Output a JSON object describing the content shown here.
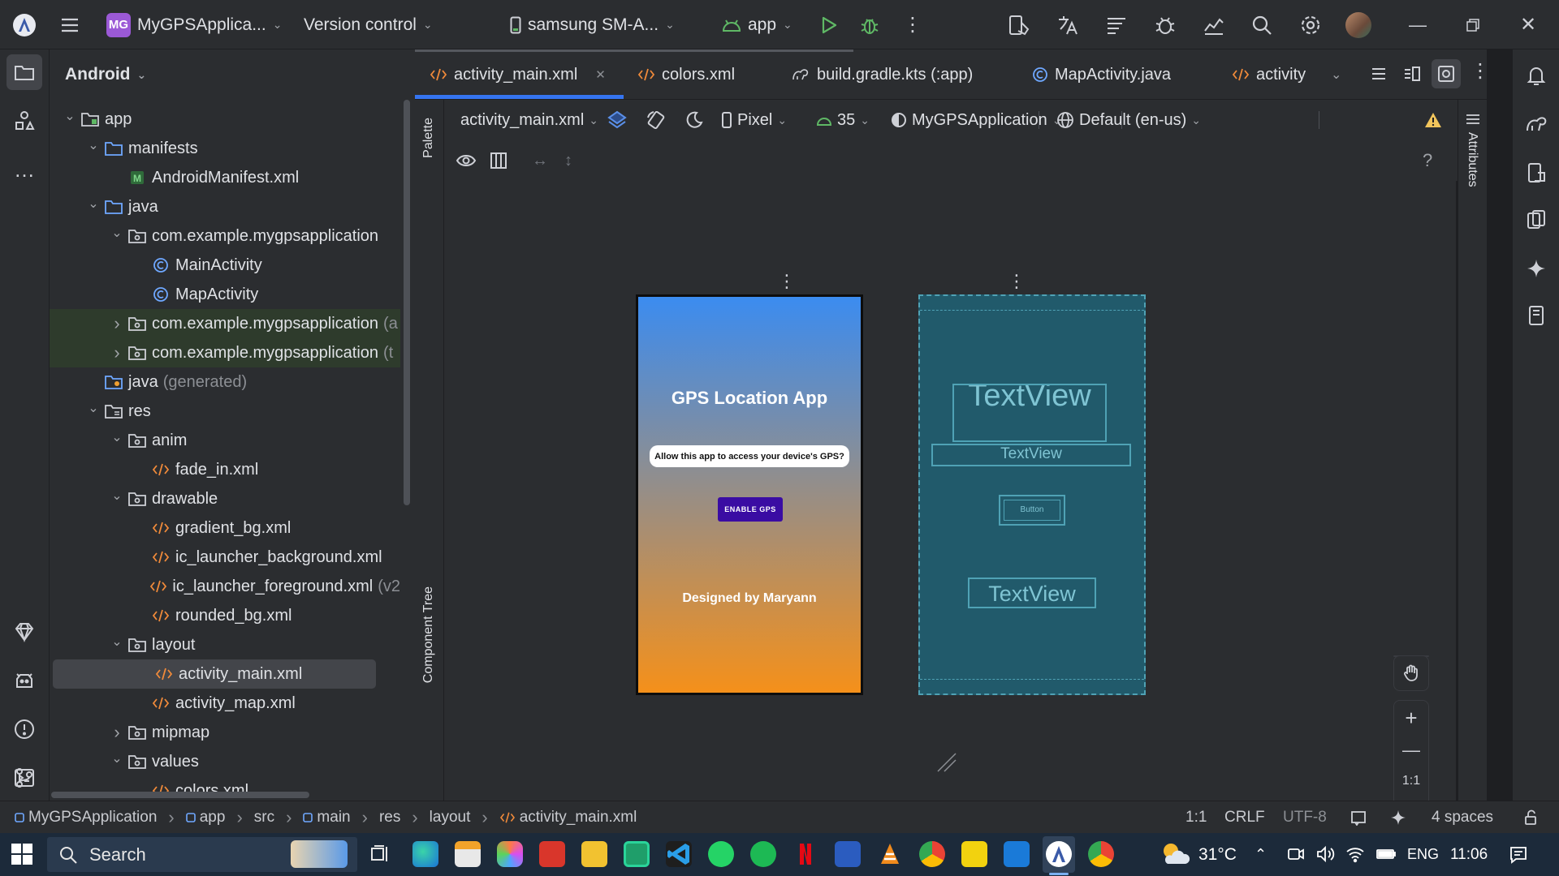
{
  "titlebar": {
    "project_badge": "MG",
    "project_name": "MyGPSApplica...",
    "vcs": "Version control",
    "device": "samsung SM-A...",
    "run_config": "app"
  },
  "project_panel": {
    "view_mode": "Android",
    "tree": [
      {
        "label": "app",
        "level": 0,
        "expand": "open",
        "icon": "module-folder-icon"
      },
      {
        "label": "manifests",
        "level": 1,
        "expand": "open",
        "icon": "folder-icon"
      },
      {
        "label": "AndroidManifest.xml",
        "level": 2,
        "expand": "none",
        "icon": "manifest-icon"
      },
      {
        "label": "java",
        "level": 1,
        "expand": "open",
        "icon": "folder-icon"
      },
      {
        "label": "com.example.mygpsapplication",
        "level": 2,
        "expand": "open",
        "icon": "package-icon"
      },
      {
        "label": "MainActivity",
        "level": 3,
        "expand": "none",
        "icon": "class-icon"
      },
      {
        "label": "MapActivity",
        "level": 3,
        "expand": "none",
        "icon": "class-icon"
      },
      {
        "label": "com.example.mygpsapplication",
        "suffix": "(a",
        "level": 2,
        "expand": "closed",
        "icon": "package-icon",
        "highlight": true
      },
      {
        "label": "com.example.mygpsapplication",
        "suffix": "(t",
        "level": 2,
        "expand": "closed",
        "icon": "package-icon",
        "highlight": true
      },
      {
        "label": "java",
        "suffix": "(generated)",
        "level": 1,
        "expand": "none",
        "icon": "generated-folder-icon"
      },
      {
        "label": "res",
        "level": 1,
        "expand": "open",
        "icon": "res-folder-icon"
      },
      {
        "label": "anim",
        "level": 2,
        "expand": "open",
        "icon": "package-icon"
      },
      {
        "label": "fade_in.xml",
        "level": 3,
        "expand": "none",
        "icon": "xml-icon"
      },
      {
        "label": "drawable",
        "level": 2,
        "expand": "open",
        "icon": "package-icon"
      },
      {
        "label": "gradient_bg.xml",
        "level": 3,
        "expand": "none",
        "icon": "xml-icon"
      },
      {
        "label": "ic_launcher_background.xml",
        "level": 3,
        "expand": "none",
        "icon": "xml-icon"
      },
      {
        "label": "ic_launcher_foreground.xml",
        "suffix": "(v2",
        "level": 3,
        "expand": "none",
        "icon": "xml-icon"
      },
      {
        "label": "rounded_bg.xml",
        "level": 3,
        "expand": "none",
        "icon": "xml-icon"
      },
      {
        "label": "layout",
        "level": 2,
        "expand": "open",
        "icon": "package-icon"
      },
      {
        "label": "activity_main.xml",
        "level": 3,
        "expand": "none",
        "icon": "xml-icon",
        "selected": true
      },
      {
        "label": "activity_map.xml",
        "level": 3,
        "expand": "none",
        "icon": "xml-icon"
      },
      {
        "label": "mipmap",
        "level": 2,
        "expand": "closed",
        "icon": "package-icon"
      },
      {
        "label": "values",
        "level": 2,
        "expand": "open",
        "icon": "package-icon"
      },
      {
        "label": "colors.xml",
        "level": 3,
        "expand": "none",
        "icon": "xml-icon"
      }
    ]
  },
  "editor": {
    "tabs": [
      {
        "label": "activity_main.xml",
        "icon": "xml-icon",
        "active": true,
        "closable": true
      },
      {
        "label": "colors.xml",
        "icon": "xml-icon"
      },
      {
        "label": "build.gradle.kts (:app)",
        "icon": "gradle-icon"
      },
      {
        "label": "MapActivity.java",
        "icon": "class-icon"
      },
      {
        "label": "activity",
        "icon": "xml-icon"
      }
    ],
    "design_toolbar": {
      "file": "activity_main.xml",
      "device": "Pixel",
      "api": "35",
      "theme": "MyGPSApplication",
      "locale": "Default (en-us)"
    },
    "side_tabs": {
      "palette": "Palette",
      "component_tree": "Component Tree",
      "attributes": "Attributes"
    },
    "preview": {
      "title": "GPS Location App",
      "message": "Allow this app to access your device's GPS?",
      "button": "ENABLE GPS",
      "footer": "Designed by Maryann",
      "gradient_top": "#3b8cf0",
      "gradient_bottom": "#f5901a",
      "button_color": "#3a0ca3"
    },
    "blueprint": {
      "title_view": "TextView",
      "message_view": "TextView",
      "button_view": "Button",
      "footer_view": "TextView"
    },
    "zoom": {
      "ratio": "1:1"
    }
  },
  "statusbar": {
    "breadcrumb": [
      "MyGPSApplication",
      "app",
      "src",
      "main",
      "res",
      "layout",
      "activity_main.xml"
    ],
    "position": "1:1",
    "line_sep": "CRLF",
    "encoding": "UTF-8",
    "indent": "4 spaces"
  },
  "taskbar": {
    "search": "Search",
    "temperature": "31°C",
    "language": "ENG",
    "time": "11:06"
  }
}
